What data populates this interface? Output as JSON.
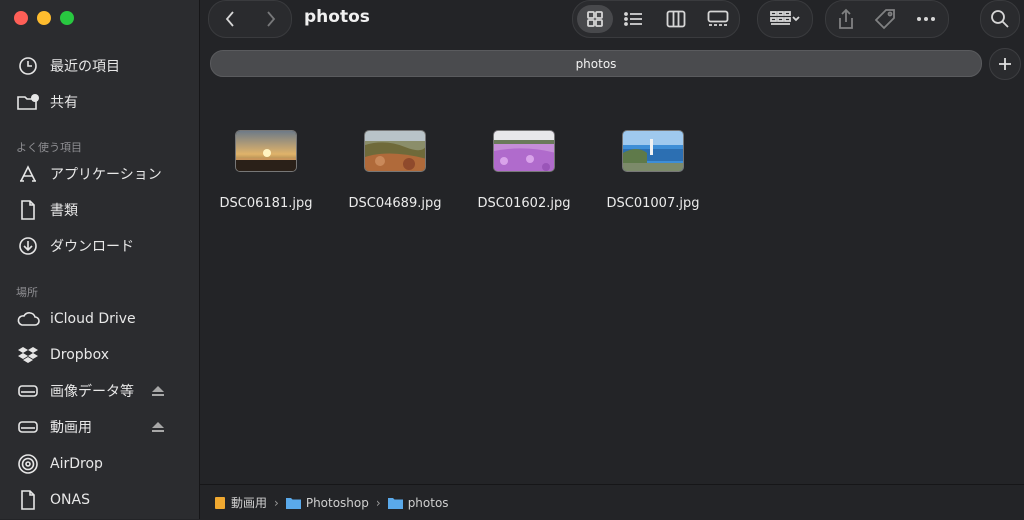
{
  "window": {
    "title": "photos"
  },
  "sidebar": {
    "top_items": [
      {
        "label": "最近の項目",
        "icon": "clock-icon"
      },
      {
        "label": "共有",
        "icon": "shared-folder-icon"
      }
    ],
    "favorites_label": "よく使う項目",
    "favorites": [
      {
        "label": "アプリケーション",
        "icon": "applications-icon"
      },
      {
        "label": "書類",
        "icon": "document-icon"
      },
      {
        "label": "ダウンロード",
        "icon": "download-icon"
      }
    ],
    "locations_label": "場所",
    "locations": [
      {
        "label": "iCloud Drive",
        "icon": "cloud-icon"
      },
      {
        "label": "Dropbox",
        "icon": "dropbox-icon"
      },
      {
        "label": "画像データ等",
        "icon": "drive-icon"
      },
      {
        "label": "動画用",
        "icon": "drive-icon"
      },
      {
        "label": "AirDrop",
        "icon": "airdrop-icon"
      },
      {
        "label": "ONAS",
        "icon": "document-icon"
      }
    ]
  },
  "pathbar": {
    "label": "photos"
  },
  "files": [
    {
      "name": "DSC06181.jpg"
    },
    {
      "name": "DSC04689.jpg"
    },
    {
      "name": "DSC01602.jpg"
    },
    {
      "name": "DSC01007.jpg"
    }
  ],
  "breadcrumb": [
    "動画用",
    "Photoshop",
    "photos"
  ],
  "colors": {
    "folder": "#5aa9ea",
    "drive_folder": "#f0a830"
  }
}
